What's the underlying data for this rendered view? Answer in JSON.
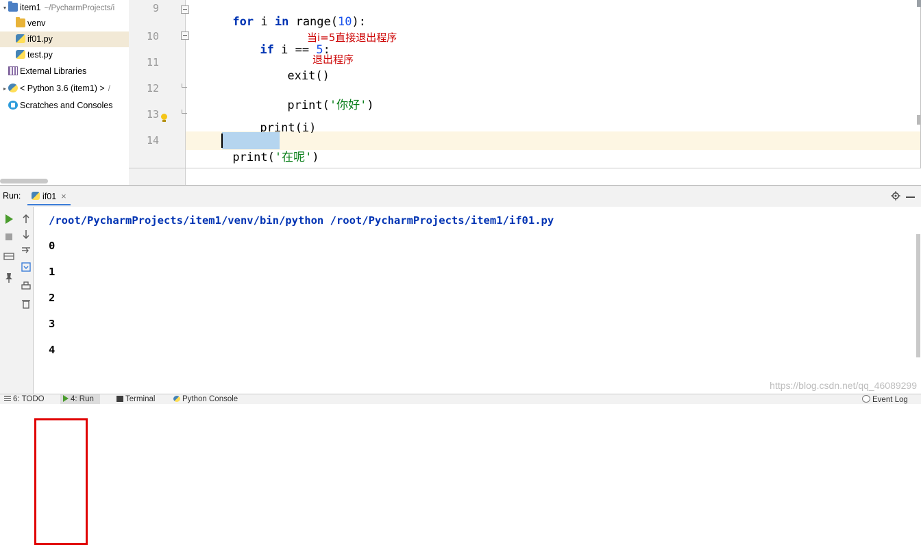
{
  "project_tree": {
    "rows": [
      {
        "label": "item1",
        "path": "~/PycharmProjects/i",
        "icon": "folder-blue-icon",
        "arrow": "▾",
        "selected": false
      },
      {
        "label": "venv",
        "path": "",
        "icon": "folder-yellow-icon",
        "arrow": "",
        "selected": false
      },
      {
        "label": "if01.py",
        "path": "",
        "icon": "python-file-icon",
        "arrow": "",
        "selected": true
      },
      {
        "label": "test.py",
        "path": "",
        "icon": "python-file-icon",
        "arrow": "",
        "selected": false
      },
      {
        "label": "External Libraries",
        "path": "",
        "icon": "library-icon",
        "arrow": "",
        "selected": false
      },
      {
        "label": "< Python 3.6 (item1) >",
        "path": "/",
        "icon": "python-interpreter-icon",
        "arrow": "▸",
        "selected": false
      },
      {
        "label": "Scratches and Consoles",
        "path": "",
        "icon": "scratches-icon",
        "arrow": "",
        "selected": false
      }
    ]
  },
  "editor": {
    "line_numbers": [
      "9",
      "10",
      "11",
      "12",
      "13",
      "14"
    ],
    "lines": [
      {
        "no": "9",
        "text": "for i in range(10):"
      },
      {
        "no": "10",
        "text": "    if i == 5:"
      },
      {
        "no": "11",
        "text": "        exit()"
      },
      {
        "no": "12",
        "text": "        print('你好')"
      },
      {
        "no": "13",
        "text": "    print(i)"
      },
      {
        "no": "14",
        "text": "print('在呢')"
      }
    ],
    "tokens": {
      "for": "for",
      "i": " i ",
      "in": "in",
      "range": " range(",
      "ten": "10",
      "close_colon": "):",
      "if": "if",
      "i2": " i == ",
      "five": "5",
      "colon": ":",
      "exit": "exit()",
      "print": "print(",
      "nihao": "'你好'",
      "paren": ")",
      "print_i": "print(i)",
      "zaine": "'在呢'"
    },
    "annotations": [
      {
        "text": "当i=5直接退出程序",
        "color": "#cc0000"
      },
      {
        "text": "退出程序",
        "color": "#cc0000"
      }
    ]
  },
  "run_panel": {
    "label": "Run:",
    "tab_name": "if01",
    "tab_close": "×",
    "gear_icon": "gear-icon",
    "minimize_icon": "minimize-icon",
    "console": {
      "command": "/root/PycharmProjects/item1/venv/bin/python /root/PycharmProjects/item1/if01.py",
      "output": [
        "0",
        "1",
        "2",
        "3",
        "4"
      ]
    }
  },
  "status_bar": {
    "items": [
      {
        "label": "6: TODO",
        "icon": "todo-icon"
      },
      {
        "label": "4: Run",
        "icon": "run-icon"
      },
      {
        "label": "Terminal",
        "icon": "terminal-icon"
      },
      {
        "label": "Python Console",
        "icon": "python-console-icon"
      },
      {
        "label": "Event Log",
        "icon": "event-log-icon"
      }
    ]
  },
  "watermark": "https://blog.csdn.net/qq_46089299",
  "colors": {
    "keyword": "#0033b3",
    "string": "#067d17",
    "number": "#1750eb",
    "comment_red": "#cc0000",
    "highlight_line": "#fdf6e3",
    "selection": "#b5d5ef",
    "red_box": "#e00000",
    "tab_underline": "#3b7dd8"
  }
}
